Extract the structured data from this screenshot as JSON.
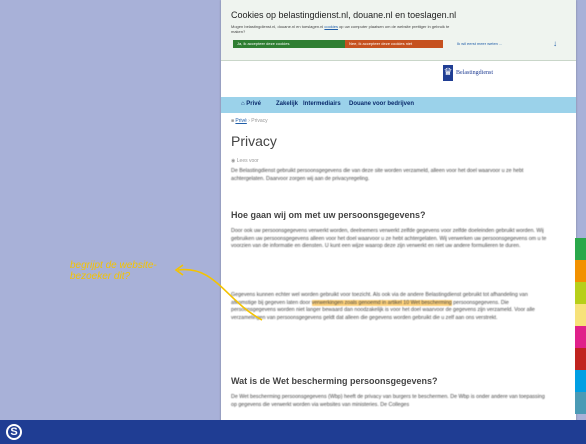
{
  "cookie_banner": {
    "title": "Cookies op belastingdienst.nl, douane.nl en toeslagen.nl",
    "text_before_link": "Mogen belastingdienst.nl, douane.nl en toeslagen.nl ",
    "text_link": "cookies",
    "text_after_link": " op uw computer plaatsen om de website prettiger in gebruik te maken?",
    "accept_label": "Ja, ik accepteer deze cookies",
    "decline_label": "Nee, ik accepteer deze cookies niet",
    "more_label": "Ik wil eerst meer weten ...",
    "more_icon": "arrow-down-icon"
  },
  "header": {
    "brand_name": "Belastingdienst",
    "crest_icon": "crest-icon"
  },
  "nav": {
    "items": [
      {
        "label": "Privé",
        "icon": "home-icon"
      },
      {
        "label": "Zakelijk"
      },
      {
        "label": "Intermediairs"
      },
      {
        "label": "Douane voor bedrijven"
      }
    ]
  },
  "breadcrumb": {
    "home": "Privé",
    "current": "Privacy"
  },
  "page": {
    "title": "Privacy",
    "meta": "Lees voor",
    "p1": "De Belastingdienst gebruikt persoonsgegevens die van deze site worden verzameld, alleen voor het doel waarvoor u ze hebt achtergelaten. Daarvoor zorgen wij aan de privacyregeling.",
    "h1": "Hoe gaan wij om met uw persoonsgegevens?",
    "p2": "Door ook uw persoonsgegevens verwerkt worden, deelnemers verwerkt zelfde gegevens voor zelfde doeleinden gebruikt worden. Wij gebruiken uw persoonsgegevens alleen voor het doel waarvoor u ze hebt achtergelaten. Wij verwerken uw persoonsgegevens om u te voorzien van de informatie en diensten. U kunt een wijze waarop deze zijn verwerkt en niet uw andere formulieren te duren.",
    "p3_before": "Gegevens kunnen echter wel worden gebruikt voor toezicht. Als ook via de andere Belastingdienst gebruikt tot afhandeling van afkomstige bij gegeven laten door ",
    "p3_highlight": "verwerkingen zoals genoemd in artikel 10 Wet bescherming",
    "p3_after": " persoonsgegevens. Die persoonsgegevens worden niet langer bewaard dan noodzakelijk is voor het doel waarvoor de gegevens zijn verzameld. Voor alle verzamelingen van persoonsgegevens geldt dat alleen die gegevens worden gebruikt die u zelf aan ons verstrekt.",
    "h2": "Wat is de Wet bescherming persoonsgegevens?",
    "p4": "De Wet bescherming persoonsgegevens (Wbp) heeft de privacy van burgers te beschermen. De Wbp is onder andere van toepassing op gegevens die verwerkt worden via websites van ministeries. De Colleges"
  },
  "annotation": {
    "text": "begrijpt de website-bezoeker dit?",
    "color": "#f4c300"
  },
  "stripes": {
    "colors": [
      "#2aa84a",
      "#f29100",
      "#b7cf1a",
      "#f7e27a",
      "#e0218a",
      "#c0231f",
      "#009fe3",
      "#4a9ab5"
    ]
  },
  "footer": {
    "logo_glyph": "S"
  }
}
